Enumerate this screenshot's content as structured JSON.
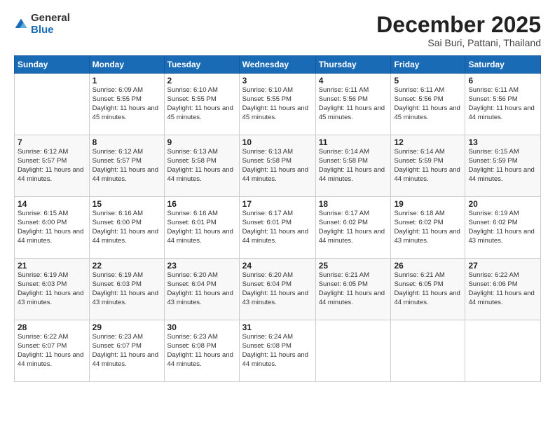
{
  "logo": {
    "general": "General",
    "blue": "Blue"
  },
  "title": {
    "month": "December 2025",
    "location": "Sai Buri, Pattani, Thailand"
  },
  "headers": [
    "Sunday",
    "Monday",
    "Tuesday",
    "Wednesday",
    "Thursday",
    "Friday",
    "Saturday"
  ],
  "weeks": [
    [
      {
        "day": "",
        "info": ""
      },
      {
        "day": "1",
        "info": "Sunrise: 6:09 AM\nSunset: 5:55 PM\nDaylight: 11 hours and 45 minutes."
      },
      {
        "day": "2",
        "info": "Sunrise: 6:10 AM\nSunset: 5:55 PM\nDaylight: 11 hours and 45 minutes."
      },
      {
        "day": "3",
        "info": "Sunrise: 6:10 AM\nSunset: 5:55 PM\nDaylight: 11 hours and 45 minutes."
      },
      {
        "day": "4",
        "info": "Sunrise: 6:11 AM\nSunset: 5:56 PM\nDaylight: 11 hours and 45 minutes."
      },
      {
        "day": "5",
        "info": "Sunrise: 6:11 AM\nSunset: 5:56 PM\nDaylight: 11 hours and 45 minutes."
      },
      {
        "day": "6",
        "info": "Sunrise: 6:11 AM\nSunset: 5:56 PM\nDaylight: 11 hours and 44 minutes."
      }
    ],
    [
      {
        "day": "7",
        "info": "Sunrise: 6:12 AM\nSunset: 5:57 PM\nDaylight: 11 hours and 44 minutes."
      },
      {
        "day": "8",
        "info": "Sunrise: 6:12 AM\nSunset: 5:57 PM\nDaylight: 11 hours and 44 minutes."
      },
      {
        "day": "9",
        "info": "Sunrise: 6:13 AM\nSunset: 5:58 PM\nDaylight: 11 hours and 44 minutes."
      },
      {
        "day": "10",
        "info": "Sunrise: 6:13 AM\nSunset: 5:58 PM\nDaylight: 11 hours and 44 minutes."
      },
      {
        "day": "11",
        "info": "Sunrise: 6:14 AM\nSunset: 5:58 PM\nDaylight: 11 hours and 44 minutes."
      },
      {
        "day": "12",
        "info": "Sunrise: 6:14 AM\nSunset: 5:59 PM\nDaylight: 11 hours and 44 minutes."
      },
      {
        "day": "13",
        "info": "Sunrise: 6:15 AM\nSunset: 5:59 PM\nDaylight: 11 hours and 44 minutes."
      }
    ],
    [
      {
        "day": "14",
        "info": "Sunrise: 6:15 AM\nSunset: 6:00 PM\nDaylight: 11 hours and 44 minutes."
      },
      {
        "day": "15",
        "info": "Sunrise: 6:16 AM\nSunset: 6:00 PM\nDaylight: 11 hours and 44 minutes."
      },
      {
        "day": "16",
        "info": "Sunrise: 6:16 AM\nSunset: 6:01 PM\nDaylight: 11 hours and 44 minutes."
      },
      {
        "day": "17",
        "info": "Sunrise: 6:17 AM\nSunset: 6:01 PM\nDaylight: 11 hours and 44 minutes."
      },
      {
        "day": "18",
        "info": "Sunrise: 6:17 AM\nSunset: 6:02 PM\nDaylight: 11 hours and 44 minutes."
      },
      {
        "day": "19",
        "info": "Sunrise: 6:18 AM\nSunset: 6:02 PM\nDaylight: 11 hours and 43 minutes."
      },
      {
        "day": "20",
        "info": "Sunrise: 6:19 AM\nSunset: 6:02 PM\nDaylight: 11 hours and 43 minutes."
      }
    ],
    [
      {
        "day": "21",
        "info": "Sunrise: 6:19 AM\nSunset: 6:03 PM\nDaylight: 11 hours and 43 minutes."
      },
      {
        "day": "22",
        "info": "Sunrise: 6:19 AM\nSunset: 6:03 PM\nDaylight: 11 hours and 43 minutes."
      },
      {
        "day": "23",
        "info": "Sunrise: 6:20 AM\nSunset: 6:04 PM\nDaylight: 11 hours and 43 minutes."
      },
      {
        "day": "24",
        "info": "Sunrise: 6:20 AM\nSunset: 6:04 PM\nDaylight: 11 hours and 43 minutes."
      },
      {
        "day": "25",
        "info": "Sunrise: 6:21 AM\nSunset: 6:05 PM\nDaylight: 11 hours and 44 minutes."
      },
      {
        "day": "26",
        "info": "Sunrise: 6:21 AM\nSunset: 6:05 PM\nDaylight: 11 hours and 44 minutes."
      },
      {
        "day": "27",
        "info": "Sunrise: 6:22 AM\nSunset: 6:06 PM\nDaylight: 11 hours and 44 minutes."
      }
    ],
    [
      {
        "day": "28",
        "info": "Sunrise: 6:22 AM\nSunset: 6:07 PM\nDaylight: 11 hours and 44 minutes."
      },
      {
        "day": "29",
        "info": "Sunrise: 6:23 AM\nSunset: 6:07 PM\nDaylight: 11 hours and 44 minutes."
      },
      {
        "day": "30",
        "info": "Sunrise: 6:23 AM\nSunset: 6:08 PM\nDaylight: 11 hours and 44 minutes."
      },
      {
        "day": "31",
        "info": "Sunrise: 6:24 AM\nSunset: 6:08 PM\nDaylight: 11 hours and 44 minutes."
      },
      {
        "day": "",
        "info": ""
      },
      {
        "day": "",
        "info": ""
      },
      {
        "day": "",
        "info": ""
      }
    ]
  ]
}
